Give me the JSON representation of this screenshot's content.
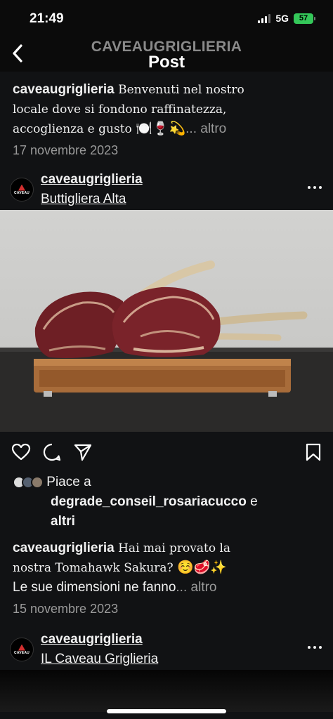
{
  "status": {
    "time": "21:49",
    "network": "5G",
    "battery": "57"
  },
  "header": {
    "username": "CAVEAUGRIGLIERIA",
    "title": "Post"
  },
  "avatar_text": "CAVEAU",
  "prev_post": {
    "username": "caveaugriglieria",
    "caption_line1": " Benvenuti nel nostro",
    "caption_line2": "locale dove si fondono raffinatezza,",
    "caption_line3": "accoglienza e gusto ",
    "caption_emoji": "🍽️🍷💫",
    "more": "... altro",
    "date": "17 novembre 2023"
  },
  "post": {
    "username": "caveaugriglieria",
    "location": "Buttigliera Alta",
    "likes_prefix": "Piace a",
    "likes_user": "degrade_conseil_rosariacucco",
    "likes_and": " e",
    "likes_others": "altri",
    "caption_user": "caveaugriglieria",
    "caption_line1": " Hai mai provato la",
    "caption_line2": "nostra Tomahawk Sakura? ",
    "caption_emoji": "☺️🥩✨",
    "caption_line3": "Le sue dimensioni ne fanno",
    "more": "... altro",
    "date": "15 novembre 2023"
  },
  "next_post": {
    "username": "caveaugriglieria",
    "location": "IL Caveau Griglieria"
  },
  "icons": {
    "back": "chevron-left-icon",
    "like": "heart-icon",
    "comment": "comment-icon",
    "share": "send-icon",
    "save": "bookmark-icon",
    "options": "more-dots-icon"
  },
  "colors": {
    "background": "#111214",
    "battery": "#34c759",
    "muted": "#9a9a9a"
  }
}
